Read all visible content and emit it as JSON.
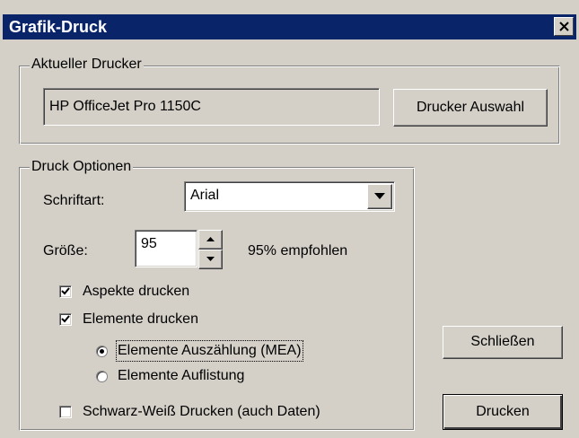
{
  "window": {
    "title": "Grafik-Druck"
  },
  "printer_group": {
    "legend": "Aktueller Drucker",
    "current_printer": "HP OfficeJet Pro 1150C",
    "select_button": "Drucker Auswahl"
  },
  "options_group": {
    "legend": "Druck Optionen",
    "font_label": "Schriftart:",
    "font_value": "Arial",
    "size_label": "Größe:",
    "size_value": "95",
    "size_hint": "95% empfohlen",
    "print_aspects": {
      "label": "Aspekte drucken",
      "checked": true
    },
    "print_elements": {
      "label": "Elemente drucken",
      "checked": true
    },
    "radio_count": {
      "label": "Elemente Auszählung (MEA)",
      "selected": true
    },
    "radio_list": {
      "label": "Elemente Auflistung",
      "selected": false
    },
    "bw_print": {
      "label": "Schwarz-Weiß Drucken (auch Daten)",
      "checked": false
    }
  },
  "buttons": {
    "close": "Schließen",
    "print": "Drucken"
  },
  "colors": {
    "titlebar": "#0a246a",
    "face": "#d4d0c8"
  }
}
